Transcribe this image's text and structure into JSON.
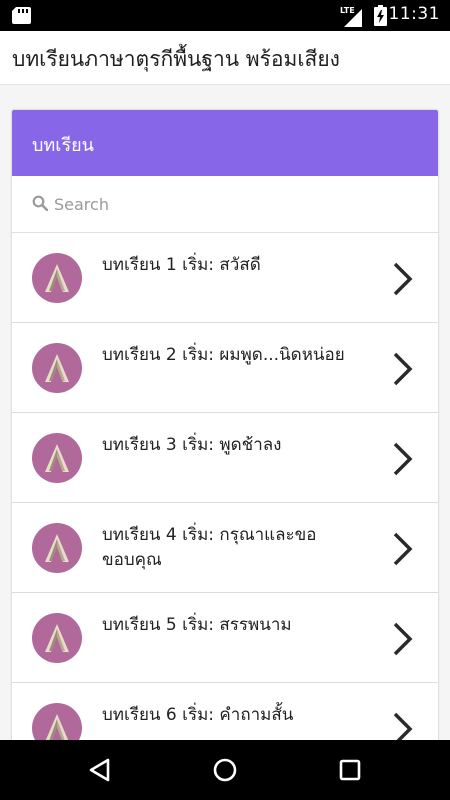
{
  "status_bar": {
    "time": "11:31",
    "network": "LTE",
    "icons": [
      "sd-card-icon",
      "lte-signal-icon",
      "battery-charging-icon"
    ]
  },
  "app_bar": {
    "title": "บทเรียนภาษาตุรกีพื้นฐาน พร้อมเสียง"
  },
  "card": {
    "header": "บทเรียน",
    "header_color": "#8866e8"
  },
  "search": {
    "placeholder": "Search",
    "value": ""
  },
  "lessons": [
    {
      "title": "บทเรียน 1 เริ่ม: สวัสดี",
      "icon": "lesson-avatar-icon"
    },
    {
      "title": "บทเรียน 2 เริ่ม: ผมพูด...นิดหน่อย",
      "icon": "lesson-avatar-icon"
    },
    {
      "title": "บทเรียน 3 เริ่ม: พูดช้าลง",
      "icon": "lesson-avatar-icon"
    },
    {
      "title": "บทเรียน 4 เริ่ม: กรุณาและขอขอบคุณ",
      "icon": "lesson-avatar-icon"
    },
    {
      "title": "บทเรียน 5 เริ่ม: สรรพนาม",
      "icon": "lesson-avatar-icon"
    },
    {
      "title": "บทเรียน 6 เริ่ม: คำถามสั้น",
      "icon": "lesson-avatar-icon"
    }
  ],
  "colors": {
    "accent": "#8866e8",
    "avatar_bg": "#b0699a",
    "nav_bar": "#000000"
  },
  "nav_bar": {
    "buttons": [
      "back-icon",
      "home-icon",
      "recent-apps-icon"
    ]
  }
}
